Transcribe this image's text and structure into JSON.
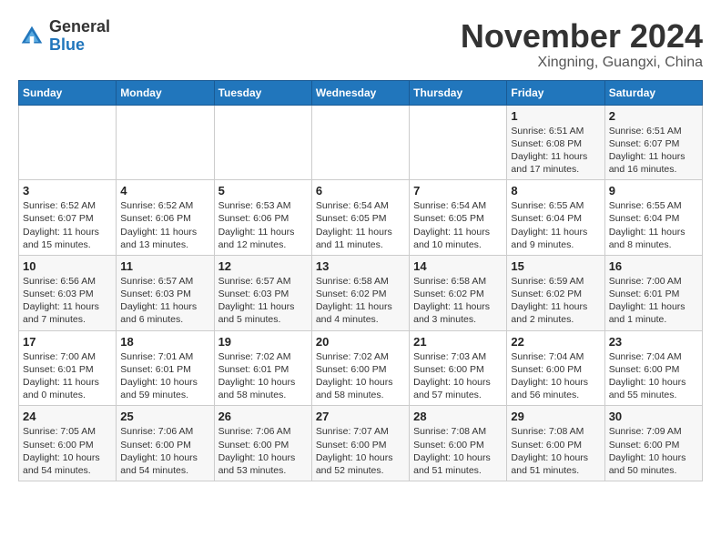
{
  "header": {
    "logo_general": "General",
    "logo_blue": "Blue",
    "month": "November 2024",
    "location": "Xingning, Guangxi, China"
  },
  "weekdays": [
    "Sunday",
    "Monday",
    "Tuesday",
    "Wednesday",
    "Thursday",
    "Friday",
    "Saturday"
  ],
  "weeks": [
    [
      {
        "day": "",
        "info": ""
      },
      {
        "day": "",
        "info": ""
      },
      {
        "day": "",
        "info": ""
      },
      {
        "day": "",
        "info": ""
      },
      {
        "day": "",
        "info": ""
      },
      {
        "day": "1",
        "info": "Sunrise: 6:51 AM\nSunset: 6:08 PM\nDaylight: 11 hours and 17 minutes."
      },
      {
        "day": "2",
        "info": "Sunrise: 6:51 AM\nSunset: 6:07 PM\nDaylight: 11 hours and 16 minutes."
      }
    ],
    [
      {
        "day": "3",
        "info": "Sunrise: 6:52 AM\nSunset: 6:07 PM\nDaylight: 11 hours and 15 minutes."
      },
      {
        "day": "4",
        "info": "Sunrise: 6:52 AM\nSunset: 6:06 PM\nDaylight: 11 hours and 13 minutes."
      },
      {
        "day": "5",
        "info": "Sunrise: 6:53 AM\nSunset: 6:06 PM\nDaylight: 11 hours and 12 minutes."
      },
      {
        "day": "6",
        "info": "Sunrise: 6:54 AM\nSunset: 6:05 PM\nDaylight: 11 hours and 11 minutes."
      },
      {
        "day": "7",
        "info": "Sunrise: 6:54 AM\nSunset: 6:05 PM\nDaylight: 11 hours and 10 minutes."
      },
      {
        "day": "8",
        "info": "Sunrise: 6:55 AM\nSunset: 6:04 PM\nDaylight: 11 hours and 9 minutes."
      },
      {
        "day": "9",
        "info": "Sunrise: 6:55 AM\nSunset: 6:04 PM\nDaylight: 11 hours and 8 minutes."
      }
    ],
    [
      {
        "day": "10",
        "info": "Sunrise: 6:56 AM\nSunset: 6:03 PM\nDaylight: 11 hours and 7 minutes."
      },
      {
        "day": "11",
        "info": "Sunrise: 6:57 AM\nSunset: 6:03 PM\nDaylight: 11 hours and 6 minutes."
      },
      {
        "day": "12",
        "info": "Sunrise: 6:57 AM\nSunset: 6:03 PM\nDaylight: 11 hours and 5 minutes."
      },
      {
        "day": "13",
        "info": "Sunrise: 6:58 AM\nSunset: 6:02 PM\nDaylight: 11 hours and 4 minutes."
      },
      {
        "day": "14",
        "info": "Sunrise: 6:58 AM\nSunset: 6:02 PM\nDaylight: 11 hours and 3 minutes."
      },
      {
        "day": "15",
        "info": "Sunrise: 6:59 AM\nSunset: 6:02 PM\nDaylight: 11 hours and 2 minutes."
      },
      {
        "day": "16",
        "info": "Sunrise: 7:00 AM\nSunset: 6:01 PM\nDaylight: 11 hours and 1 minute."
      }
    ],
    [
      {
        "day": "17",
        "info": "Sunrise: 7:00 AM\nSunset: 6:01 PM\nDaylight: 11 hours and 0 minutes."
      },
      {
        "day": "18",
        "info": "Sunrise: 7:01 AM\nSunset: 6:01 PM\nDaylight: 10 hours and 59 minutes."
      },
      {
        "day": "19",
        "info": "Sunrise: 7:02 AM\nSunset: 6:01 PM\nDaylight: 10 hours and 58 minutes."
      },
      {
        "day": "20",
        "info": "Sunrise: 7:02 AM\nSunset: 6:00 PM\nDaylight: 10 hours and 58 minutes."
      },
      {
        "day": "21",
        "info": "Sunrise: 7:03 AM\nSunset: 6:00 PM\nDaylight: 10 hours and 57 minutes."
      },
      {
        "day": "22",
        "info": "Sunrise: 7:04 AM\nSunset: 6:00 PM\nDaylight: 10 hours and 56 minutes."
      },
      {
        "day": "23",
        "info": "Sunrise: 7:04 AM\nSunset: 6:00 PM\nDaylight: 10 hours and 55 minutes."
      }
    ],
    [
      {
        "day": "24",
        "info": "Sunrise: 7:05 AM\nSunset: 6:00 PM\nDaylight: 10 hours and 54 minutes."
      },
      {
        "day": "25",
        "info": "Sunrise: 7:06 AM\nSunset: 6:00 PM\nDaylight: 10 hours and 54 minutes."
      },
      {
        "day": "26",
        "info": "Sunrise: 7:06 AM\nSunset: 6:00 PM\nDaylight: 10 hours and 53 minutes."
      },
      {
        "day": "27",
        "info": "Sunrise: 7:07 AM\nSunset: 6:00 PM\nDaylight: 10 hours and 52 minutes."
      },
      {
        "day": "28",
        "info": "Sunrise: 7:08 AM\nSunset: 6:00 PM\nDaylight: 10 hours and 51 minutes."
      },
      {
        "day": "29",
        "info": "Sunrise: 7:08 AM\nSunset: 6:00 PM\nDaylight: 10 hours and 51 minutes."
      },
      {
        "day": "30",
        "info": "Sunrise: 7:09 AM\nSunset: 6:00 PM\nDaylight: 10 hours and 50 minutes."
      }
    ]
  ]
}
